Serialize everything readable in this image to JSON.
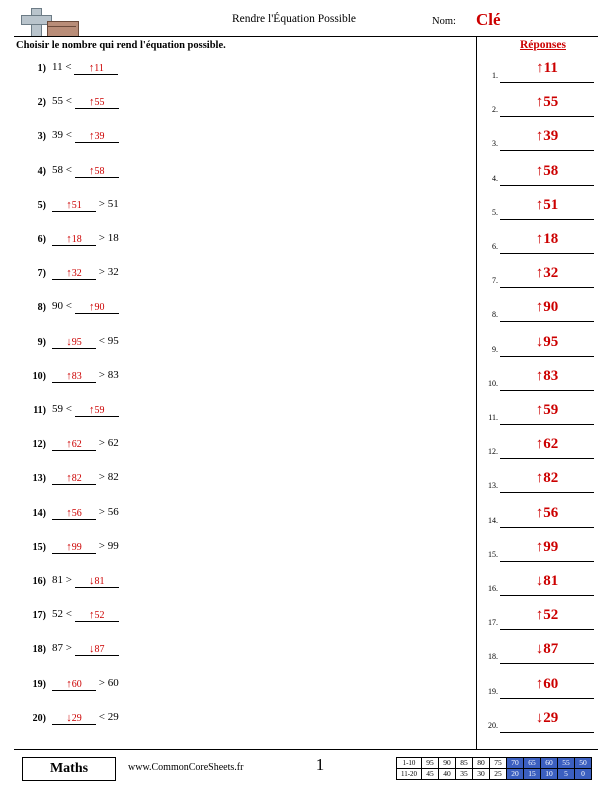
{
  "header": {
    "title": "Rendre l'Équation Possible",
    "name_label": "Nom:",
    "key_label": "Clé",
    "logo_icon": "cross-and-book-icon"
  },
  "instruction": "Choisir le nombre qui rend l'équation possible.",
  "answers_header": "Réponses",
  "problems": [
    {
      "num": "1)",
      "left": "11 <",
      "right": "",
      "blank": "11",
      "arrow": "↑",
      "blank_side": "right"
    },
    {
      "num": "2)",
      "left": "55 <",
      "right": "",
      "blank": "55",
      "arrow": "↑",
      "blank_side": "right"
    },
    {
      "num": "3)",
      "left": "39 <",
      "right": "",
      "blank": "39",
      "arrow": "↑",
      "blank_side": "right"
    },
    {
      "num": "4)",
      "left": "58 <",
      "right": "",
      "blank": "58",
      "arrow": "↑",
      "blank_side": "right"
    },
    {
      "num": "5)",
      "left": "",
      "right": "> 51",
      "blank": "51",
      "arrow": "↑",
      "blank_side": "left"
    },
    {
      "num": "6)",
      "left": "",
      "right": "> 18",
      "blank": "18",
      "arrow": "↑",
      "blank_side": "left"
    },
    {
      "num": "7)",
      "left": "",
      "right": "> 32",
      "blank": "32",
      "arrow": "↑",
      "blank_side": "left"
    },
    {
      "num": "8)",
      "left": "90 <",
      "right": "",
      "blank": "90",
      "arrow": "↑",
      "blank_side": "right"
    },
    {
      "num": "9)",
      "left": "",
      "right": "< 95",
      "blank": "95",
      "arrow": "↓",
      "blank_side": "left"
    },
    {
      "num": "10)",
      "left": "",
      "right": "> 83",
      "blank": "83",
      "arrow": "↑",
      "blank_side": "left"
    },
    {
      "num": "11)",
      "left": "59 <",
      "right": "",
      "blank": "59",
      "arrow": "↑",
      "blank_side": "right"
    },
    {
      "num": "12)",
      "left": "",
      "right": "> 62",
      "blank": "62",
      "arrow": "↑",
      "blank_side": "left"
    },
    {
      "num": "13)",
      "left": "",
      "right": "> 82",
      "blank": "82",
      "arrow": "↑",
      "blank_side": "left"
    },
    {
      "num": "14)",
      "left": "",
      "right": "> 56",
      "blank": "56",
      "arrow": "↑",
      "blank_side": "left"
    },
    {
      "num": "15)",
      "left": "",
      "right": "> 99",
      "blank": "99",
      "arrow": "↑",
      "blank_side": "left"
    },
    {
      "num": "16)",
      "left": "81 >",
      "right": "",
      "blank": "81",
      "arrow": "↓",
      "blank_side": "right"
    },
    {
      "num": "17)",
      "left": "52 <",
      "right": "",
      "blank": "52",
      "arrow": "↑",
      "blank_side": "right"
    },
    {
      "num": "18)",
      "left": "87 >",
      "right": "",
      "blank": "87",
      "arrow": "↓",
      "blank_side": "right"
    },
    {
      "num": "19)",
      "left": "",
      "right": "> 60",
      "blank": "60",
      "arrow": "↑",
      "blank_side": "left"
    },
    {
      "num": "20)",
      "left": "",
      "right": "< 29",
      "blank": "29",
      "arrow": "↓",
      "blank_side": "left"
    }
  ],
  "answers": [
    {
      "num": "1.",
      "arrow": "↑",
      "value": "11"
    },
    {
      "num": "2.",
      "arrow": "↑",
      "value": "55"
    },
    {
      "num": "3.",
      "arrow": "↑",
      "value": "39"
    },
    {
      "num": "4.",
      "arrow": "↑",
      "value": "58"
    },
    {
      "num": "5.",
      "arrow": "↑",
      "value": "51"
    },
    {
      "num": "6.",
      "arrow": "↑",
      "value": "18"
    },
    {
      "num": "7.",
      "arrow": "↑",
      "value": "32"
    },
    {
      "num": "8.",
      "arrow": "↑",
      "value": "90"
    },
    {
      "num": "9.",
      "arrow": "↓",
      "value": "95"
    },
    {
      "num": "10.",
      "arrow": "↑",
      "value": "83"
    },
    {
      "num": "11.",
      "arrow": "↑",
      "value": "59"
    },
    {
      "num": "12.",
      "arrow": "↑",
      "value": "62"
    },
    {
      "num": "13.",
      "arrow": "↑",
      "value": "82"
    },
    {
      "num": "14.",
      "arrow": "↑",
      "value": "56"
    },
    {
      "num": "15.",
      "arrow": "↑",
      "value": "99"
    },
    {
      "num": "16.",
      "arrow": "↓",
      "value": "81"
    },
    {
      "num": "17.",
      "arrow": "↑",
      "value": "52"
    },
    {
      "num": "18.",
      "arrow": "↓",
      "value": "87"
    },
    {
      "num": "19.",
      "arrow": "↑",
      "value": "60"
    },
    {
      "num": "20.",
      "arrow": "↓",
      "value": "29"
    }
  ],
  "footer": {
    "subject": "Maths",
    "website": "www.CommonCoreSheets.fr",
    "page_number": "1",
    "score_table": {
      "row1_label": "1-10",
      "row2_label": "11-20",
      "row1": [
        "95",
        "90",
        "85",
        "80",
        "75",
        "70",
        "65",
        "60",
        "55",
        "50"
      ],
      "row2": [
        "45",
        "40",
        "35",
        "30",
        "25",
        "20",
        "15",
        "10",
        "5",
        "0"
      ],
      "highlight_from_index": 5,
      "highlight_color": "#3b5fc0"
    }
  }
}
